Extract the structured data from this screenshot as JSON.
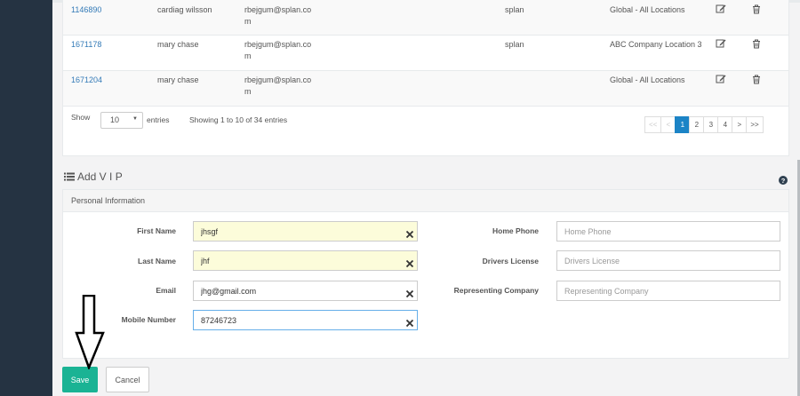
{
  "table": {
    "rows": [
      {
        "id": "1146890",
        "name": "cardiag wilsson",
        "email": "rbejgum@splan.com",
        "dept": "splan",
        "location": "Global - All Locations"
      },
      {
        "id": "1671178",
        "name": "mary chase",
        "email": "rbejgum@splan.com",
        "dept": "splan",
        "location": "ABC Company Location 3"
      },
      {
        "id": "1671204",
        "name": "mary chase",
        "email": "rbejgum@splan.com",
        "dept": "",
        "location": "Global - All Locations"
      }
    ],
    "show_label": "Show",
    "page_length": "10",
    "entries_label": "entries",
    "info": "Showing 1 to 10 of 34 entries",
    "pagination": [
      "<<",
      "<",
      "1",
      "2",
      "3",
      "4",
      ">",
      ">>"
    ],
    "active_page": "1"
  },
  "section": {
    "title": "Add V I P"
  },
  "form": {
    "header": "Personal Information",
    "first_name": {
      "label": "First Name",
      "value": "jhsgf"
    },
    "last_name": {
      "label": "Last Name",
      "value": "jhf"
    },
    "email": {
      "label": "Email",
      "value": "jhg@gmail.com"
    },
    "mobile": {
      "label": "Mobile Number",
      "value": "87246723"
    },
    "home_phone": {
      "label": "Home Phone",
      "placeholder": "Home Phone"
    },
    "drivers_license": {
      "label": "Drivers License",
      "placeholder": "Drivers License"
    },
    "representing_company": {
      "label": "Representing Company",
      "placeholder": "Representing Company"
    }
  },
  "buttons": {
    "save": "Save",
    "cancel": "Cancel"
  },
  "icons": {
    "edit": "edit-icon",
    "delete": "trash-icon",
    "list": "list-icon",
    "help": "question-circle-icon",
    "clear": "close-icon"
  },
  "colors": {
    "sidebar": "#253342",
    "primary": "#1ab394",
    "link": "#337ab7",
    "active_page": "#1c84c6",
    "autofill": "#fcfcda"
  }
}
